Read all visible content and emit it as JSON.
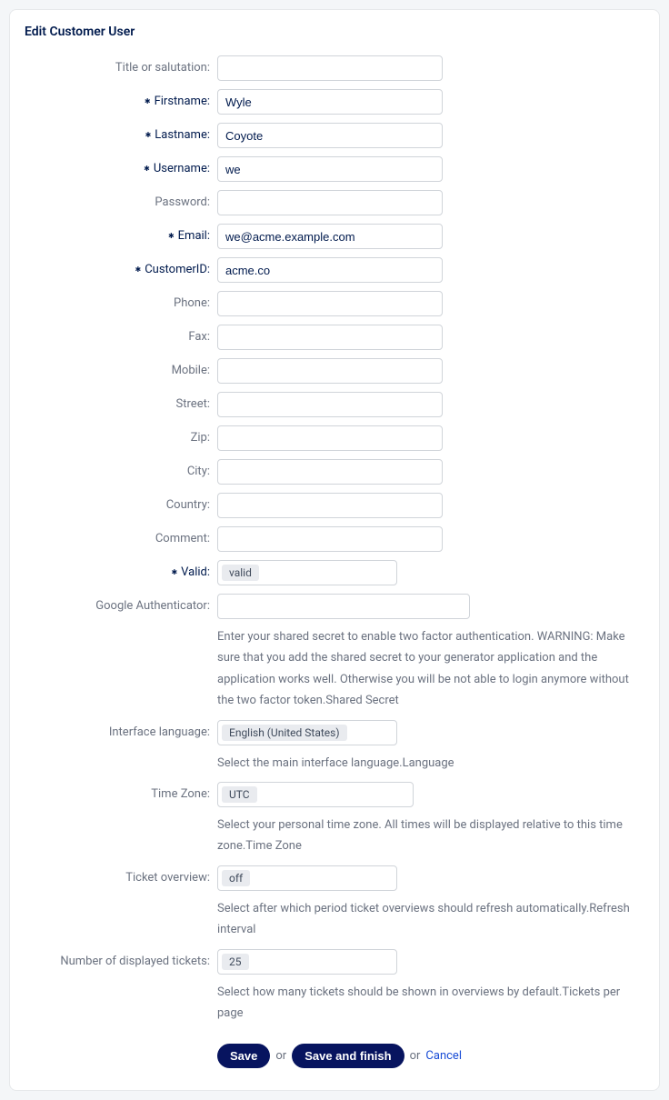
{
  "panel": {
    "title": "Edit Customer User"
  },
  "labels": {
    "title": "Title or salutation:",
    "firstname": "Firstname:",
    "lastname": "Lastname:",
    "username": "Username:",
    "password": "Password:",
    "email": "Email:",
    "customerid": "CustomerID:",
    "phone": "Phone:",
    "fax": "Fax:",
    "mobile": "Mobile:",
    "street": "Street:",
    "zip": "Zip:",
    "city": "City:",
    "country": "Country:",
    "comment": "Comment:",
    "valid": "Valid:",
    "gauth": "Google Authenticator:",
    "lang": "Interface language:",
    "tz": "Time Zone:",
    "ticket_overview": "Ticket overview:",
    "num_tickets": "Number of displayed tickets:"
  },
  "values": {
    "title": "",
    "firstname": "Wyle",
    "lastname": "Coyote",
    "username": "we",
    "password": "",
    "email": "we@acme.example.com",
    "customerid": "acme.co",
    "phone": "",
    "fax": "",
    "mobile": "",
    "street": "",
    "zip": "",
    "city": "",
    "country": "",
    "comment": "",
    "valid": "valid",
    "lang": "English (United States)",
    "tz": "UTC",
    "ticket_overview": "off",
    "num_tickets": "25"
  },
  "help": {
    "gauth": "Enter your shared secret to enable two factor authentication. WARNING: Make sure that you add the shared secret to your generator application and the application works well. Otherwise you will be not able to login anymore without the two factor token.Shared Secret",
    "lang": "Select the main interface language.Language",
    "tz": "Select your personal time zone. All times will be displayed relative to this time zone.Time Zone",
    "ticket_overview": "Select after which period ticket overviews should refresh automatically.Refresh interval",
    "num_tickets": "Select how many tickets should be shown in overviews by default.Tickets per page"
  },
  "actions": {
    "save": "Save",
    "or1": "or",
    "save_finish": "Save and finish",
    "or2": "or",
    "cancel": "Cancel"
  }
}
